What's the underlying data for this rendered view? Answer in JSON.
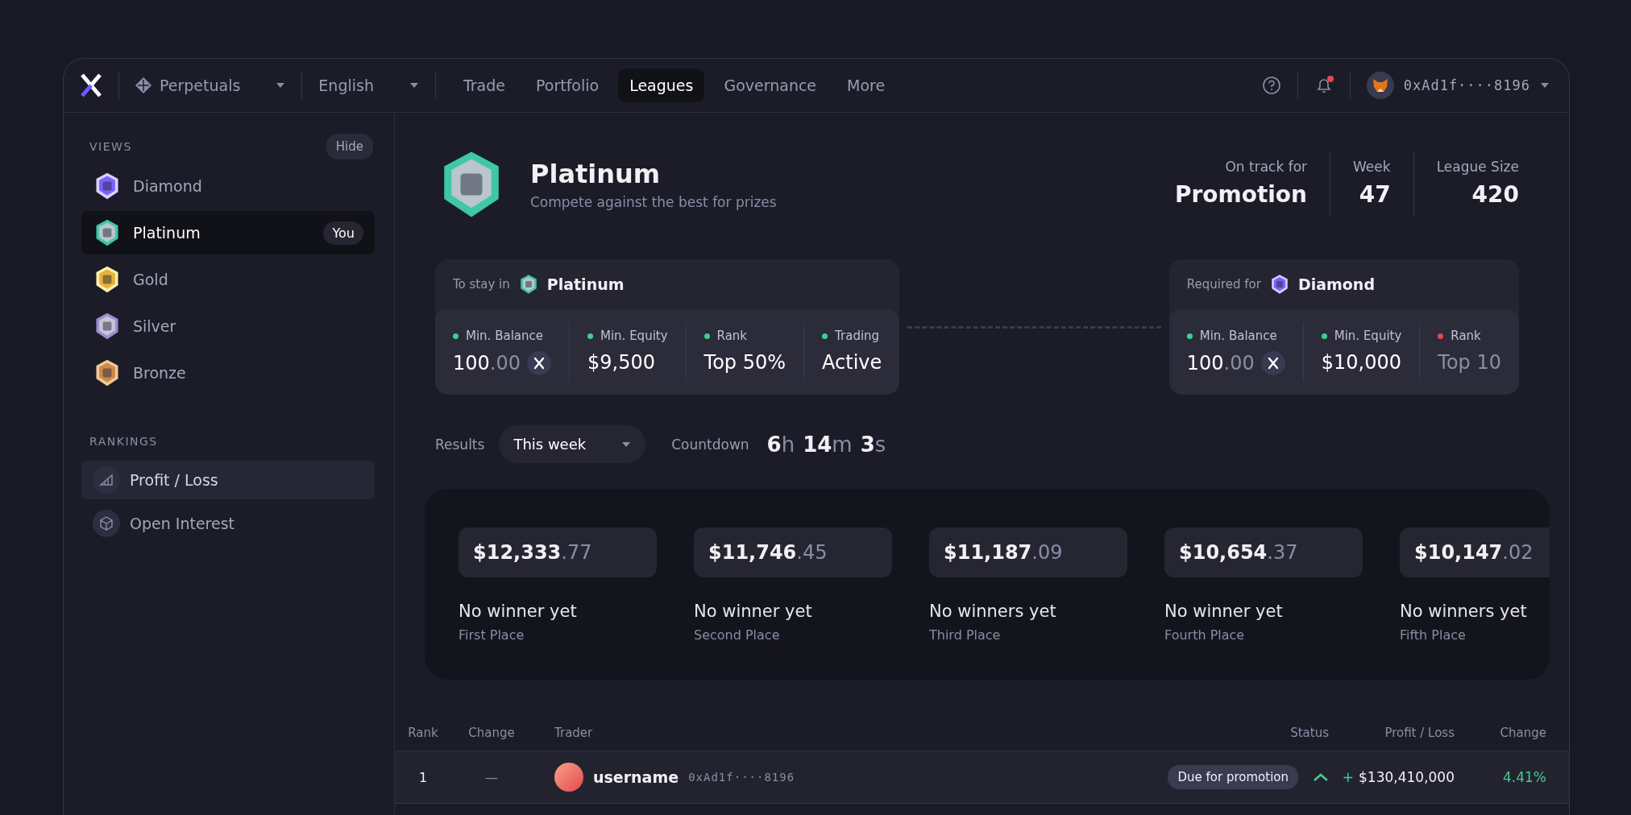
{
  "nav": {
    "market_selector": {
      "label": "Perpetuals"
    },
    "language_selector": {
      "label": "English"
    },
    "tabs": [
      {
        "label": "Trade",
        "selected": false
      },
      {
        "label": "Portfolio",
        "selected": false
      },
      {
        "label": "Leagues",
        "selected": true
      },
      {
        "label": "Governance",
        "selected": false
      },
      {
        "label": "More",
        "selected": false
      }
    ],
    "notifications": {
      "unread": true
    },
    "account": {
      "address": "0xAd1f····8196"
    }
  },
  "sidebar": {
    "views_heading": "VIEWS",
    "hide_button": "Hide",
    "leagues": [
      {
        "name": "Diamond",
        "kind": "diamond",
        "selected": false
      },
      {
        "name": "Platinum",
        "kind": "platinum",
        "selected": true,
        "badge": "You"
      },
      {
        "name": "Gold",
        "kind": "gold",
        "selected": false
      },
      {
        "name": "Silver",
        "kind": "silver",
        "selected": false
      },
      {
        "name": "Bronze",
        "kind": "bronze",
        "selected": false
      }
    ],
    "rankings_heading": "RANKINGS",
    "rankings": [
      {
        "label": "Profit / Loss",
        "kind": "chart",
        "selected": true
      },
      {
        "label": "Open Interest",
        "kind": "cube",
        "selected": false
      }
    ]
  },
  "league": {
    "kind": "platinum",
    "name": "Platinum",
    "subtitle": "Compete against the best for prizes",
    "stats": [
      {
        "label": "On track for",
        "value": "Promotion"
      },
      {
        "label": "Week",
        "value": "47"
      },
      {
        "label": "League Size",
        "value": "420"
      }
    ]
  },
  "requirements": [
    {
      "lead": "To stay in",
      "kind": "platinum",
      "league": "Platinum",
      "items": [
        {
          "label": "Min. Balance",
          "kind": "token",
          "whole": "100",
          "fraction": ".00",
          "color": "#3ecf8e",
          "met": true
        },
        {
          "label": "Min. Equity",
          "kind": "plain",
          "whole": "$9,500",
          "color": "#3ecf8e",
          "met": true
        },
        {
          "label": "Rank",
          "kind": "plain",
          "whole": "Top 50%",
          "color": "#3ecf8e",
          "met": true
        },
        {
          "label": "Trading",
          "kind": "plain",
          "whole": "Active",
          "color": "#3ecf8e",
          "met": true
        }
      ]
    },
    {
      "lead": "Required for",
      "kind": "diamond",
      "league": "Diamond",
      "items": [
        {
          "label": "Min. Balance",
          "kind": "token",
          "whole": "100",
          "fraction": ".00",
          "color": "#3ecf8e",
          "met": true
        },
        {
          "label": "Min. Equity",
          "kind": "plain",
          "whole": "$10,000",
          "color": "#3ecf8e",
          "met": true
        },
        {
          "label": "Rank",
          "kind": "plain",
          "whole": "Top 10",
          "color": "#e5484d",
          "met": false
        }
      ]
    }
  ],
  "results": {
    "label": "Results",
    "period": "This week",
    "countdown_label": "Countdown",
    "countdown": [
      {
        "value": "6",
        "unit": "h"
      },
      {
        "value": "14",
        "unit": "m"
      },
      {
        "value": "3",
        "unit": "s"
      }
    ]
  },
  "prizes": [
    {
      "whole": "$12,333",
      "fraction": ".77",
      "winner": "No winner yet",
      "place": "First Place"
    },
    {
      "whole": "$11,746",
      "fraction": ".45",
      "winner": "No winner yet",
      "place": "Second Place"
    },
    {
      "whole": "$11,187",
      "fraction": ".09",
      "winner": "No winners yet",
      "place": "Third Place"
    },
    {
      "whole": "$10,654",
      "fraction": ".37",
      "winner": "No winner yet",
      "place": "Fourth Place"
    },
    {
      "whole": "$10,147",
      "fraction": ".02",
      "winner": "No winners yet",
      "place": "Fifth Place"
    }
  ],
  "leaderboard": {
    "columns": [
      "Rank",
      "Change",
      "Trader",
      "Status",
      "Profit / Loss",
      "Change"
    ],
    "rows": [
      {
        "rank": "1",
        "change": "—",
        "username": "username",
        "address": "0xAd1f····8196",
        "status": "Due for promotion",
        "kind": "up",
        "sign": "+",
        "pnl": "$130,410,000",
        "pct": "4.41%"
      }
    ]
  }
}
